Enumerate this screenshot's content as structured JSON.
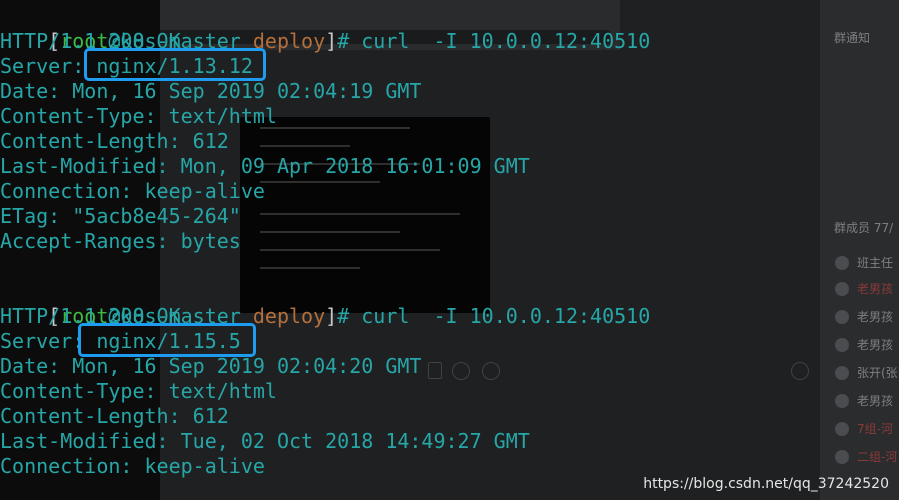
{
  "background": {
    "notice_title": "群通知",
    "members_label": "群成员 77/",
    "members": [
      "班主任",
      "老男孩",
      "老男孩",
      "老男孩",
      "张开(张",
      "老男孩",
      "7组-河",
      "二组-河"
    ]
  },
  "terminal": {
    "prompt1": {
      "user": "root",
      "host": "@k8s-master",
      "dir": "deploy",
      "command": "# curl  -I 10.0.0.12:40510"
    },
    "block1": [
      "HTTP/1.1 200 OK",
      "Server: nginx/1.13.12",
      "Date: Mon, 16 Sep 2019 02:04:19 GMT",
      "Content-Type: text/html",
      "Content-Length: 612",
      "Last-Modified: Mon, 09 Apr 2018 16:01:09 GMT",
      "Connection: keep-alive",
      "ETag: \"5acb8e45-264\"",
      "Accept-Ranges: bytes"
    ],
    "prompt2": {
      "user": "root",
      "host": "@k8s-master",
      "dir": "deploy",
      "command": "# curl  -I 10.0.0.12:40510"
    },
    "block2": [
      "HTTP/1.1 200 OK",
      "Server: nginx/1.15.5",
      "Date: Mon, 16 Sep 2019 02:04:20 GMT",
      "Content-Type: text/html",
      "Content-Length: 612",
      "Last-Modified: Tue, 02 Oct 2018 14:49:27 GMT",
      "Connection: keep-alive"
    ]
  },
  "watermark": "https://blog.csdn.net/qq_37242520",
  "colors": {
    "terminal_text": "#27a6a8",
    "user": "#3db843",
    "directory": "#b3703c",
    "highlight_box": "#1d9cf0"
  }
}
